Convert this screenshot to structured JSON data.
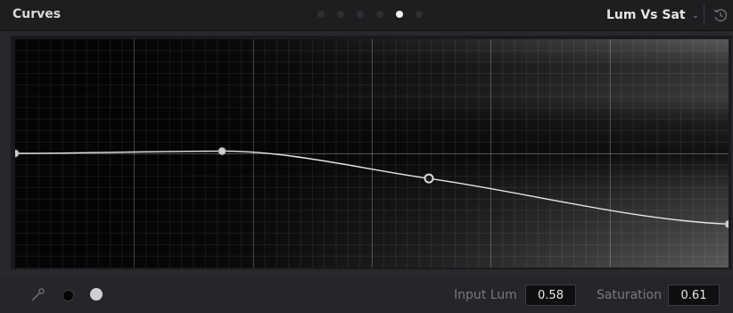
{
  "header": {
    "title": "Curves",
    "page_dots": {
      "count": 6,
      "active_index": 4
    },
    "mode": "Lum Vs Sat",
    "mode_chevron_icon": "chevron-down-icon",
    "reset_icon": "reset-icon"
  },
  "curve": {
    "control_points": [
      {
        "input_lum": 0.0,
        "saturation": 0.5
      },
      {
        "input_lum": 0.29,
        "saturation": 0.49
      },
      {
        "input_lum": 0.58,
        "saturation": 0.61
      },
      {
        "input_lum": 1.0,
        "saturation": 0.81
      }
    ]
  },
  "footer": {
    "picker_icon": "eyedropper-icon",
    "black_point_icon": "black-dot-icon",
    "white_point_icon": "white-dot-icon",
    "input_label": "Input Lum",
    "input_value": "0.58",
    "output_label": "Saturation",
    "output_value": "0.61"
  },
  "colors": {
    "curve": "#e6e6e6",
    "point_fill": "#cfcfd2",
    "point_selected_ring": "#dcdcdc"
  }
}
